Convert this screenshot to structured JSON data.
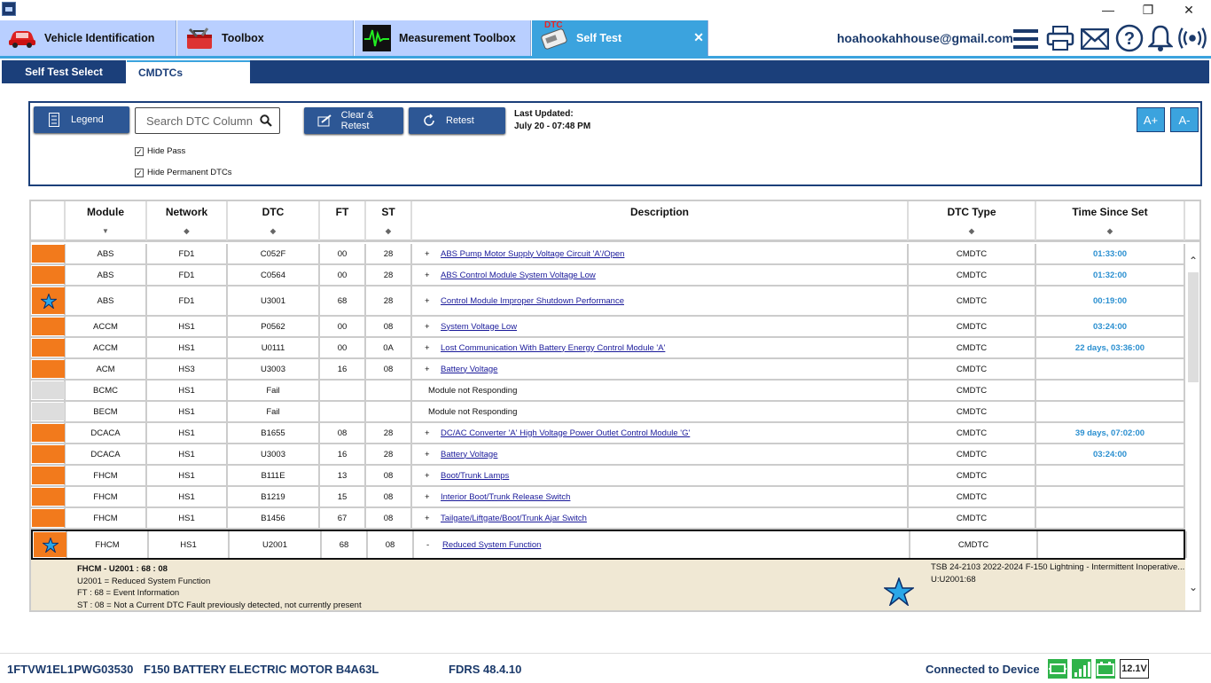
{
  "window": {
    "minimize": "—",
    "restore": "❐",
    "close": "✕"
  },
  "tabs": [
    {
      "label": "Vehicle Identification",
      "icon": "car-icon"
    },
    {
      "label": "Toolbox",
      "icon": "toolbox-icon"
    },
    {
      "label": "Measurement Toolbox",
      "icon": "oscilloscope-icon"
    },
    {
      "label": "Self Test",
      "icon": "dtc-icon",
      "badge": "DTC",
      "close": "✕"
    }
  ],
  "user": {
    "email": "hoahookahhouse@gmail.com"
  },
  "subtabs": [
    {
      "label": "Self Test Select"
    },
    {
      "label": "CMDTCs"
    }
  ],
  "toolbar": {
    "legend_label": "Legend",
    "search_placeholder": "Search DTC Column",
    "clear_retest_label": "Clear & Retest",
    "retest_label": "Retest",
    "last_updated_label": "Last Updated:",
    "last_updated_value": "July 20 - 07:48 PM",
    "font_increase": "A+",
    "font_decrease": "A-",
    "hide_pass_label": "Hide Pass",
    "hide_permanent_label": "Hide Permanent DTCs",
    "hide_pass_checked": true,
    "hide_permanent_checked": true
  },
  "table": {
    "columns": [
      "Module",
      "Network",
      "DTC",
      "FT",
      "ST",
      "Description",
      "DTC Type",
      "Time Since Set"
    ],
    "sort_icons": [
      "▼",
      "◆",
      "◆",
      "",
      "◆",
      "",
      "◆",
      "◆"
    ],
    "rows": [
      {
        "status": "orange",
        "star": false,
        "module": "ABS",
        "network": "FD1",
        "dtc": "C052F",
        "ft": "00",
        "st": "28",
        "sign": "+",
        "description": "ABS Pump Motor Supply Voltage Circuit 'A'/Open",
        "desc_link": true,
        "type": "CMDTC",
        "time": "01:33:00"
      },
      {
        "status": "orange",
        "star": false,
        "module": "ABS",
        "network": "FD1",
        "dtc": "C0564",
        "ft": "00",
        "st": "28",
        "sign": "+",
        "description": "ABS Control Module System Voltage Low",
        "desc_link": true,
        "type": "CMDTC",
        "time": "01:32:00"
      },
      {
        "status": "orange",
        "star": true,
        "module": "ABS",
        "network": "FD1",
        "dtc": "U3001",
        "ft": "68",
        "st": "28",
        "sign": "+",
        "description": "Control Module Improper Shutdown Performance",
        "desc_link": true,
        "type": "CMDTC",
        "time": "00:19:00"
      },
      {
        "status": "orange",
        "star": false,
        "module": "ACCM",
        "network": "HS1",
        "dtc": "P0562",
        "ft": "00",
        "st": "08",
        "sign": "+",
        "description": "System Voltage Low",
        "desc_link": true,
        "type": "CMDTC",
        "time": "03:24:00"
      },
      {
        "status": "orange",
        "star": false,
        "module": "ACCM",
        "network": "HS1",
        "dtc": "U0111",
        "ft": "00",
        "st": "0A",
        "sign": "+",
        "description": "Lost Communication With Battery Energy Control Module 'A'",
        "desc_link": true,
        "type": "CMDTC",
        "time": "22 days, 03:36:00"
      },
      {
        "status": "orange",
        "star": false,
        "module": "ACM",
        "network": "HS3",
        "dtc": "U3003",
        "ft": "16",
        "st": "08",
        "sign": "+",
        "description": "Battery Voltage",
        "desc_link": true,
        "type": "CMDTC",
        "time": ""
      },
      {
        "status": "gray",
        "star": false,
        "module": "BCMC",
        "network": "HS1",
        "dtc": "Fail",
        "ft": "",
        "st": "",
        "sign": "",
        "description": "Module not Responding",
        "desc_link": false,
        "type": "CMDTC",
        "time": ""
      },
      {
        "status": "gray",
        "star": false,
        "module": "BECM",
        "network": "HS1",
        "dtc": "Fail",
        "ft": "",
        "st": "",
        "sign": "",
        "description": "Module not Responding",
        "desc_link": false,
        "type": "CMDTC",
        "time": ""
      },
      {
        "status": "orange",
        "star": false,
        "module": "DCACA",
        "network": "HS1",
        "dtc": "B1655",
        "ft": "08",
        "st": "28",
        "sign": "+",
        "description": "DC/AC Converter 'A' High Voltage Power Outlet Control Module 'G'",
        "desc_link": true,
        "type": "CMDTC",
        "time": "39 days, 07:02:00"
      },
      {
        "status": "orange",
        "star": false,
        "module": "DCACA",
        "network": "HS1",
        "dtc": "U3003",
        "ft": "16",
        "st": "28",
        "sign": "+",
        "description": "Battery Voltage",
        "desc_link": true,
        "type": "CMDTC",
        "time": "03:24:00"
      },
      {
        "status": "orange",
        "star": false,
        "module": "FHCM",
        "network": "HS1",
        "dtc": "B111E",
        "ft": "13",
        "st": "08",
        "sign": "+",
        "description": "Boot/Trunk Lamps",
        "desc_link": true,
        "type": "CMDTC",
        "time": ""
      },
      {
        "status": "orange",
        "star": false,
        "module": "FHCM",
        "network": "HS1",
        "dtc": "B1219",
        "ft": "15",
        "st": "08",
        "sign": "+",
        "description": "Interior Boot/Trunk Release Switch",
        "desc_link": true,
        "type": "CMDTC",
        "time": ""
      },
      {
        "status": "orange",
        "star": false,
        "module": "FHCM",
        "network": "HS1",
        "dtc": "B1456",
        "ft": "67",
        "st": "08",
        "sign": "+",
        "description": "Tailgate/Liftgate/Boot/Trunk Ajar Switch",
        "desc_link": true,
        "type": "CMDTC",
        "time": ""
      },
      {
        "status": "orange",
        "star": true,
        "module": "FHCM",
        "network": "HS1",
        "dtc": "U2001",
        "ft": "68",
        "st": "08",
        "sign": "-",
        "description": "Reduced System Function",
        "desc_link": true,
        "type": "CMDTC",
        "time": "",
        "expanded": true
      }
    ],
    "detail": {
      "title": "FHCM - U2001 : 68 : 08",
      "lines": [
        "U2001 = Reduced System Function",
        "FT : 68 = Event Information",
        "ST : 08 = Not a Current DTC Fault previously detected, not currently present"
      ],
      "tsb_title": "TSB 24-2103 2022-2024 F-150 Lightning - Intermittent Inoperative...",
      "tsb_code": "U:U2001:68"
    }
  },
  "statusbar": {
    "vin": "1FTVW1EL1PWG03530",
    "vehicle": "F150 BATTERY ELECTRIC MOTOR B4A63L",
    "version": "FDRS 48.4.10",
    "connection": "Connected to Device",
    "voltage": "12.1V"
  },
  "colors": {
    "accent": "#3ba3de",
    "navy": "#1b3f7a",
    "tab_inactive": "#b9cfff",
    "fault_flag": "#f27a1c",
    "link": "#1a1a9a",
    "time_text": "#2a8fd0",
    "detail_bg": "#f0e8d4",
    "status_green": "#2fb34a"
  }
}
